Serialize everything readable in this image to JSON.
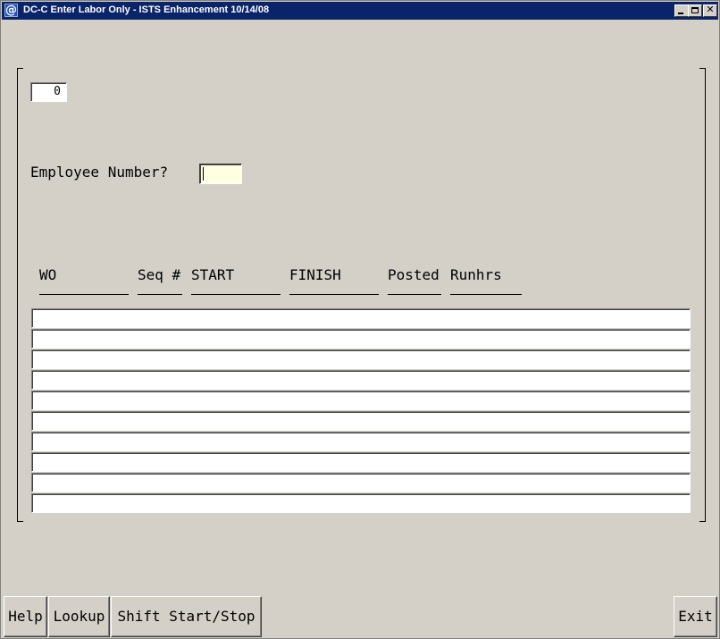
{
  "window": {
    "title": "DC-C  Enter Labor Only - ISTS Enhancement 10/14/08",
    "icon": "@"
  },
  "counter": {
    "value": "0"
  },
  "employee": {
    "label": "Employee Number?",
    "value": ""
  },
  "table": {
    "columns": [
      "WO",
      "Seq #",
      "START",
      "FINISH",
      "Posted",
      "Runhrs"
    ],
    "row_count": 10
  },
  "buttons": {
    "help": "Help",
    "lookup": "Lookup",
    "shift": "Shift Start/Stop",
    "exit": "Exit"
  }
}
